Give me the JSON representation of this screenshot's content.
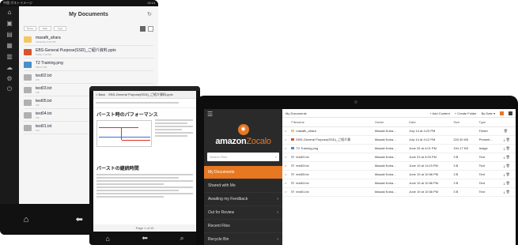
{
  "phone": {
    "status_left": "中国 ポストイメージ",
    "status_right": "13:14",
    "title": "My Documents",
    "toolbar_segments": [
      "Name",
      "Date",
      "Type"
    ],
    "rail_icons": [
      "home-icon",
      "inbox-icon",
      "folder-icon",
      "calendar-icon",
      "doc-icon",
      "cloud-icon",
      "gear-icon",
      "power-icon"
    ],
    "files": [
      {
        "name": "masafk_ahara",
        "sub": "Yesterday 4:15 PM",
        "kind": "folder"
      },
      {
        "name": "EBS-General Purpose(SSD)_ご紹介資料.pptx",
        "sub": "Today 4:12 PM",
        "kind": "pptx"
      },
      {
        "name": "T2 Training.png",
        "sub": "195.17 KB",
        "kind": "png"
      },
      {
        "name": "test02.txt",
        "sub": "3 B",
        "kind": "txt"
      },
      {
        "name": "test03.txt",
        "sub": "3 B",
        "kind": "txt"
      },
      {
        "name": "test05.txt",
        "sub": "3 B",
        "kind": "txt"
      },
      {
        "name": "test04.txt",
        "sub": "3 B",
        "kind": "txt"
      },
      {
        "name": "test01.txt",
        "sub": "3 B",
        "kind": "txt"
      }
    ]
  },
  "tablet": {
    "header_back": "< Back",
    "header_title": "EBS-General Purpose(SSD)_ご紹介資料.pptx",
    "section1_title": "バースト時のパフォーマンス",
    "section2_title": "バーストの継続時間",
    "pager": "Page 1 of 10"
  },
  "laptop": {
    "logo_main": "amazon",
    "logo_sub": "Zocalo",
    "search_placeholder": "Search Files",
    "nav": [
      {
        "label": "My Documents",
        "active": true
      },
      {
        "label": "Shared with Me",
        "active": false
      },
      {
        "label": "Awaiting my Feedback",
        "active": false
      },
      {
        "label": "Out for Review",
        "active": false
      },
      {
        "label": "Recent Files",
        "active": false
      },
      {
        "label": "Recycle Bin",
        "active": false
      }
    ],
    "breadcrumb": "My Documents",
    "add_content": "+ Add Content",
    "create_folder": "+ Create Folder",
    "sort": "By Date ▾",
    "columns": [
      "Filename",
      "Owner",
      "Date",
      "Size",
      "Type"
    ],
    "files": [
      {
        "name": "masafk_ahara",
        "owner": "Masaki Kuba…",
        "date": "July 14 at 4:23 PM",
        "size": "",
        "type": "Folder",
        "kind": "folder"
      },
      {
        "name": "EBS-General Purpose(SSD)_ご紹介資",
        "owner": "Masaki Koba…",
        "date": "July 14 at 4:12 PM",
        "size": "220.30 KB",
        "type": "Present…",
        "kind": "pptx"
      },
      {
        "name": "T2 Training.png",
        "owner": "Masaki Koba…",
        "date": "June 26 at 4:01 PM",
        "size": "194.17 KB",
        "type": "Image",
        "kind": "png"
      },
      {
        "name": "test02.txt",
        "owner": "Masaki Koba…",
        "date": "June 23 at 3:00 PM",
        "size": "3 B",
        "type": "Text",
        "kind": "txt"
      },
      {
        "name": "test03.txt",
        "owner": "Masaki Koba…",
        "date": "June 19 at 11:03 PM",
        "size": "3 B",
        "type": "Text",
        "kind": "txt"
      },
      {
        "name": "test05.txt",
        "owner": "Masaki Koba…",
        "date": "June 19 at 10:56 PM",
        "size": "3 B",
        "type": "Text",
        "kind": "txt"
      },
      {
        "name": "test04.txt",
        "owner": "Masaki Koba…",
        "date": "June 19 at 10:56 PM",
        "size": "3 B",
        "type": "Text",
        "kind": "txt"
      },
      {
        "name": "test01.txt",
        "owner": "Masaki Koba…",
        "date": "June 19 at 10:56 PM",
        "size": "3 B",
        "type": "Text",
        "kind": "txt"
      }
    ]
  },
  "colors": {
    "accent": "#e87722",
    "sidebar": "#2a2a2a",
    "device": "#111111"
  }
}
